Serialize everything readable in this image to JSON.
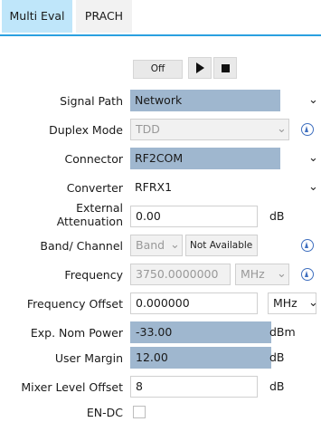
{
  "tabs": [
    {
      "label": "Multi Eval",
      "active": true
    },
    {
      "label": "PRACH",
      "active": false
    }
  ],
  "controls": {
    "off_label": "Off",
    "play_icon": "play-icon",
    "stop_icon": "stop-icon"
  },
  "form": {
    "signal_path": {
      "label": "Signal Path",
      "value": "Network"
    },
    "duplex_mode": {
      "label": "Duplex Mode",
      "value": "TDD"
    },
    "connector": {
      "label": "Connector",
      "value": "RF2COM"
    },
    "converter": {
      "label": "Converter",
      "value": "RFRX1"
    },
    "external_attenuation": {
      "label_line1": "External",
      "label_line2": "Attenuation",
      "value": "0.00",
      "unit": "dB"
    },
    "band_channel": {
      "label": "Band/ Channel",
      "band_value": "Band",
      "channel_value": "Not Available"
    },
    "frequency": {
      "label": "Frequency",
      "value": "3750.0000000",
      "unit": "MHz"
    },
    "frequency_offset": {
      "label": "Frequency Offset",
      "value": "0.000000",
      "unit": "MHz"
    },
    "exp_nom_power": {
      "label": "Exp. Nom Power",
      "value": "-33.00",
      "unit": "dBm"
    },
    "user_margin": {
      "label": "User Margin",
      "value": "12.00",
      "unit": "dB"
    },
    "mixer_level_offset": {
      "label": "Mixer Level Offset",
      "value": "8",
      "unit": "dB"
    },
    "en_dc": {
      "label": "EN-DC",
      "checked": false
    }
  },
  "colors": {
    "tab_active": "#bfe6fa",
    "tab_underline": "#2aa0e0",
    "highlight": "#9fb7cf",
    "info_icon": "#3f6fbf"
  }
}
